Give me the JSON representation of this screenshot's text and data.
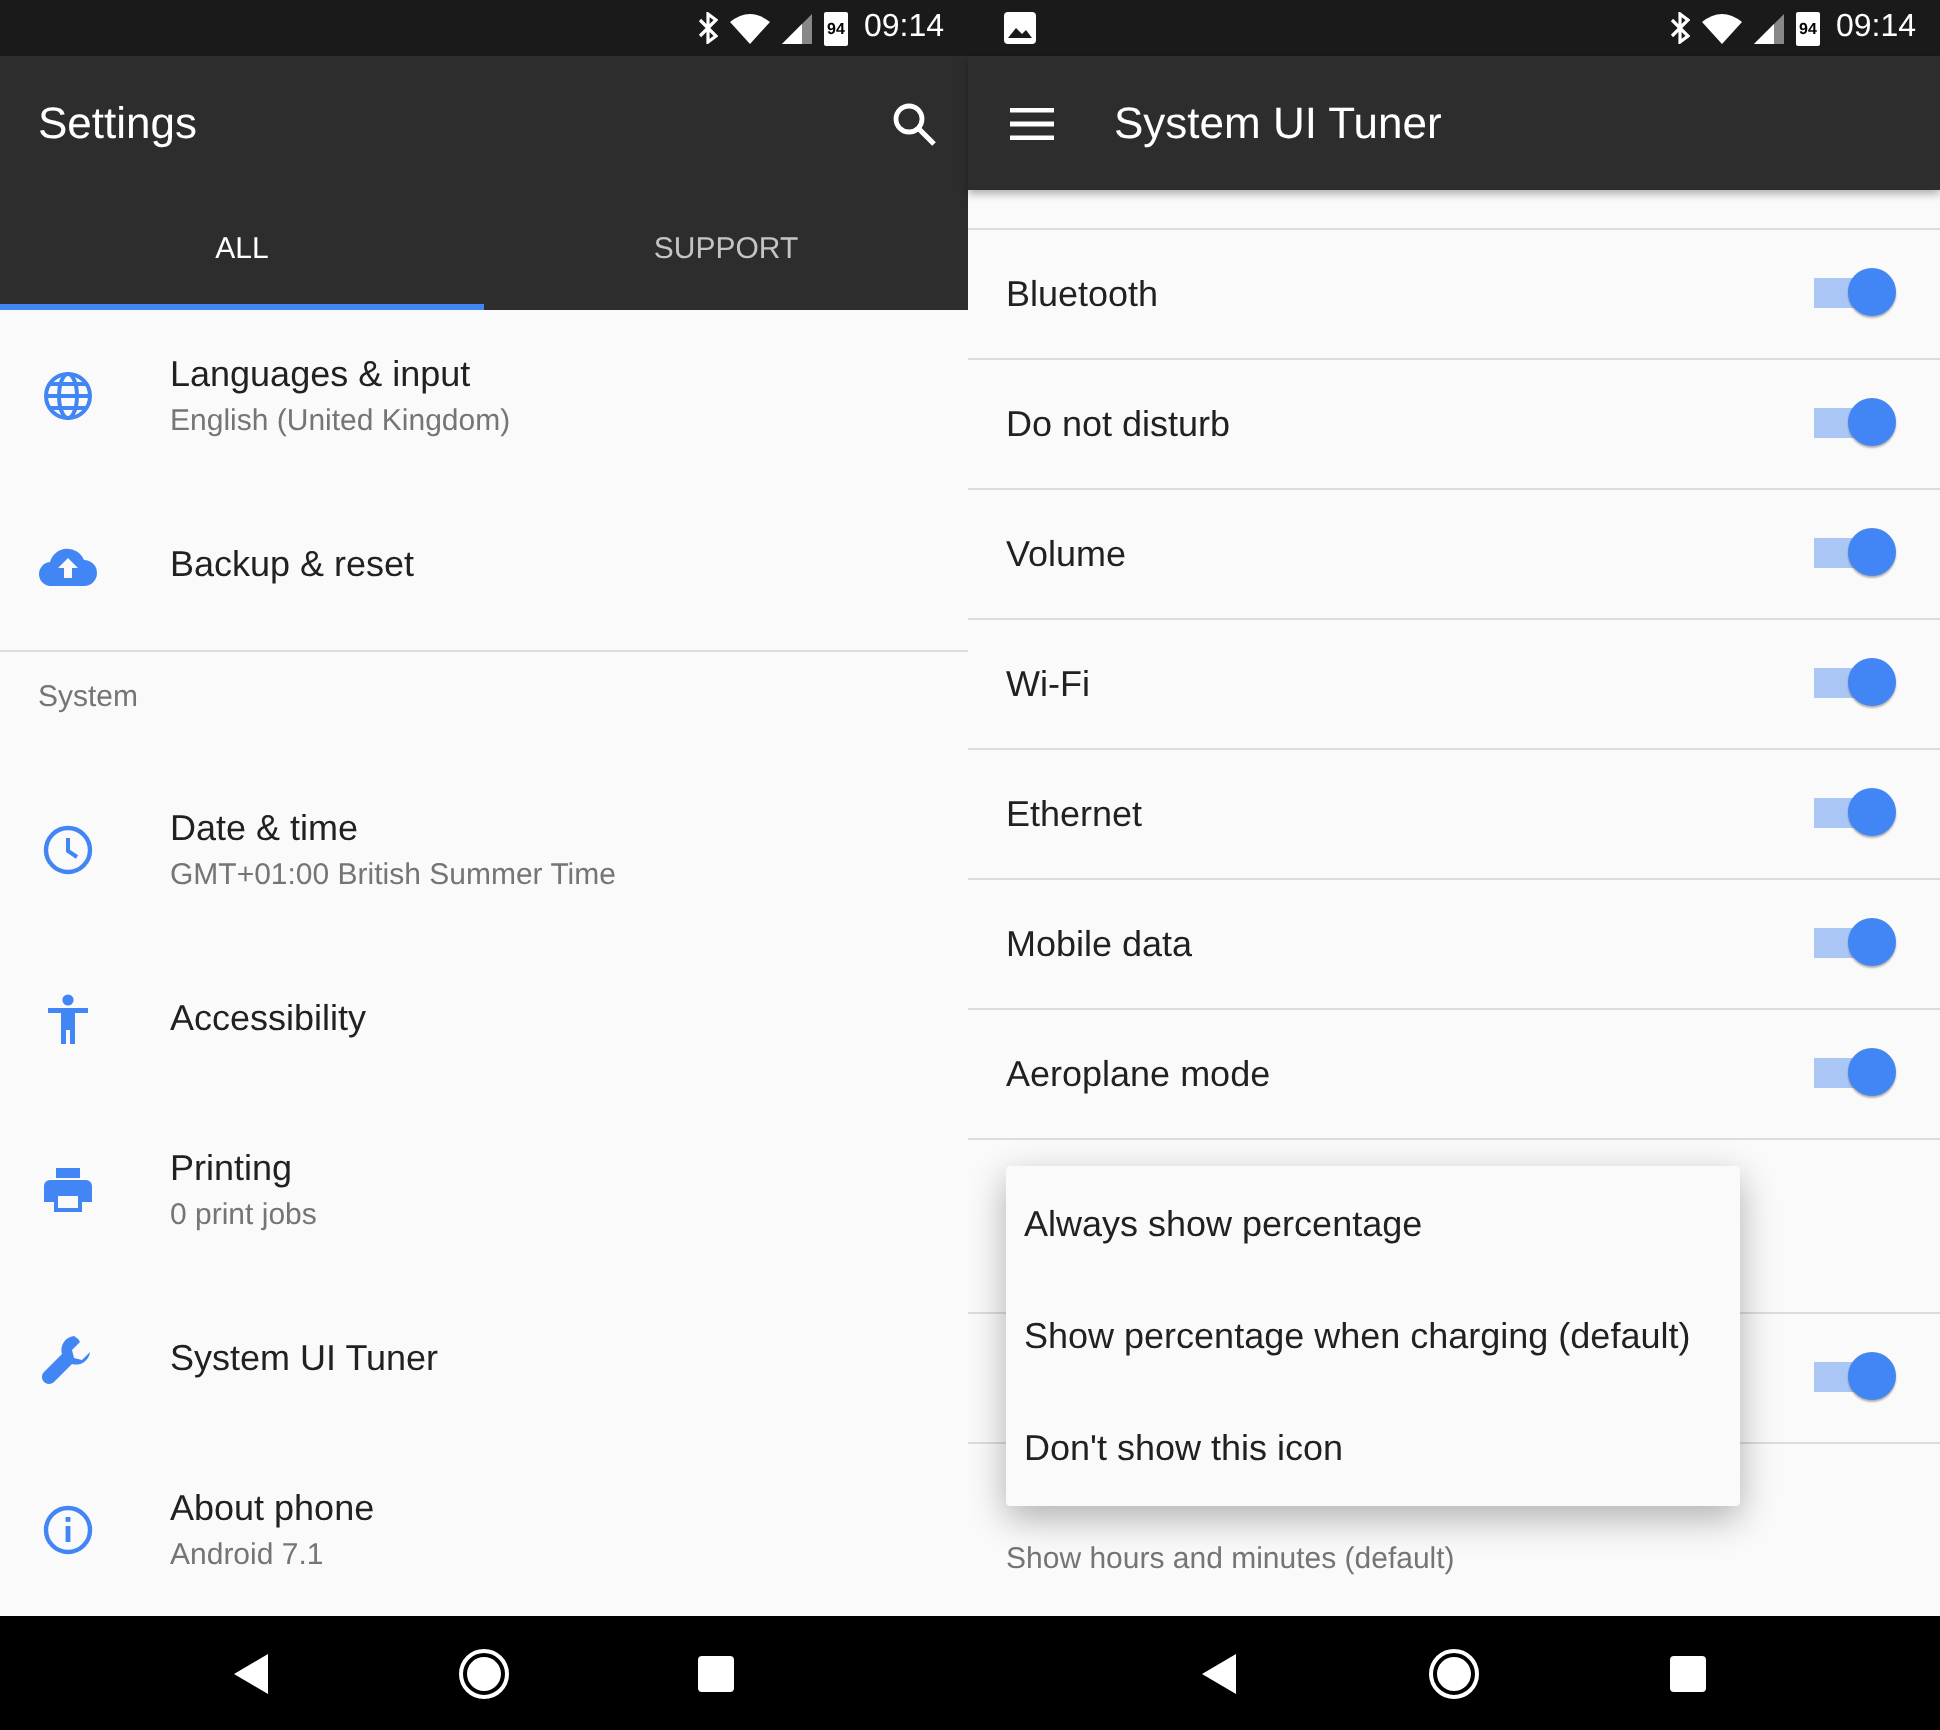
{
  "left_screen": {
    "status_bar": {
      "battery": "94",
      "time": "09:14"
    },
    "app_bar": {
      "title": "Settings"
    },
    "tabs": [
      {
        "label": "ALL",
        "selected": true
      },
      {
        "label": "SUPPORT",
        "selected": false
      }
    ],
    "sections": [
      {
        "items": [
          {
            "title": "Languages & input",
            "subtitle": "English (United Kingdom)"
          },
          {
            "title": "Backup & reset"
          }
        ]
      },
      {
        "header": "System",
        "items": [
          {
            "title": "Date & time",
            "subtitle": "GMT+01:00 British Summer Time"
          },
          {
            "title": "Accessibility"
          },
          {
            "title": "Printing",
            "subtitle": "0 print jobs"
          },
          {
            "title": "System UI Tuner"
          },
          {
            "title": "About phone",
            "subtitle": "Android 7.1"
          }
        ]
      }
    ]
  },
  "right_screen": {
    "status_bar": {
      "battery": "94",
      "time": "09:14"
    },
    "toolbar": {
      "title": "System UI Tuner"
    },
    "toggles": [
      {
        "label": "Bluetooth",
        "on": true
      },
      {
        "label": "Do not disturb",
        "on": true
      },
      {
        "label": "Volume",
        "on": true
      },
      {
        "label": "Wi-Fi",
        "on": true
      },
      {
        "label": "Ethernet",
        "on": true
      },
      {
        "label": "Mobile data",
        "on": true
      },
      {
        "label": "Aeroplane mode",
        "on": true
      }
    ],
    "covered_toggle": {
      "on": true
    },
    "time_row": {
      "subtitle": "Show hours and minutes (default)"
    },
    "popup_menu": [
      "Always show percentage",
      "Show percentage when charging (default)",
      "Don't show this icon"
    ]
  }
}
